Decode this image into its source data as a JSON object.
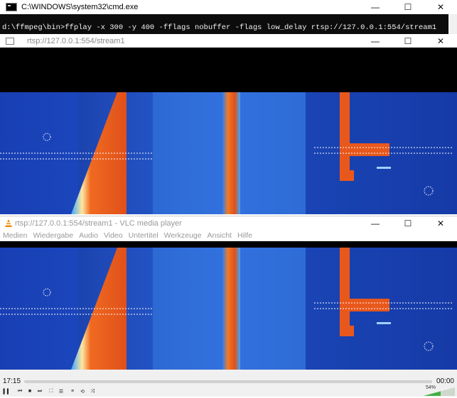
{
  "cmd_window": {
    "title": "C:\\WINDOWS\\system32\\cmd.exe",
    "command_line": "d:\\ffmpeg\\bin>ffplay -x 300 -y 400 -fflags nobuffer -flags low_delay rtsp://127.0.0.1:554/stream1"
  },
  "ffplay_window": {
    "title": "rtsp://127.0.0.1:554/stream1"
  },
  "vlc_window": {
    "title": "rtsp://127.0.0.1:554/stream1 - VLC media player",
    "menu": [
      "Medien",
      "Wiedergabe",
      "Audio",
      "Video",
      "Untertitel",
      "Werkzeuge",
      "Ansicht",
      "Hilfe"
    ],
    "time_elapsed": "17:15",
    "time_total": "00:00",
    "volume_label": "54%"
  },
  "window_buttons": {
    "minimize": "—",
    "maximize": "☐",
    "close": "✕"
  },
  "colors": {
    "thermal_hot": "#e0501a",
    "thermal_cold": "#1b3fbf",
    "console_bg": "#0c0c0c",
    "vlc_orange": "#f08a00"
  }
}
